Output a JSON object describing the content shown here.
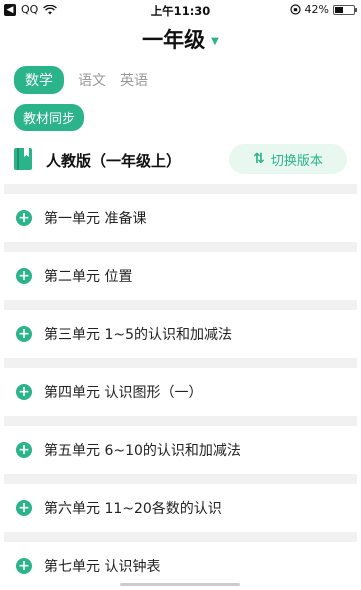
{
  "status": {
    "back_glyph": "◀",
    "carrier": "QQ",
    "wifi": "wifi-icon",
    "time": "上午11:30",
    "lock": "rotation-lock-icon",
    "battery": "42%"
  },
  "header": {
    "title": "一年级",
    "caret": "▼"
  },
  "subjects": [
    {
      "label": "数学",
      "active": true
    },
    {
      "label": "语文",
      "active": false
    },
    {
      "label": "英语",
      "active": false
    }
  ],
  "sync_label": "教材同步",
  "edition": {
    "label": "人教版（一年级上）",
    "switch_label": "切换版本",
    "switch_icon": "⇅"
  },
  "units": [
    {
      "label": "第一单元  准备课"
    },
    {
      "label": "第二单元  位置"
    },
    {
      "label": "第三单元  1~5的认识和加减法"
    },
    {
      "label": "第四单元  认识图形（一）"
    },
    {
      "label": "第五单元  6~10的认识和加减法"
    },
    {
      "label": "第六单元  11~20各数的认识"
    },
    {
      "label": "第七单元  认识钟表"
    }
  ],
  "colors": {
    "accent": "#2bb38a",
    "accent_light": "#e9f7f1",
    "divider": "#f1f1f1"
  }
}
